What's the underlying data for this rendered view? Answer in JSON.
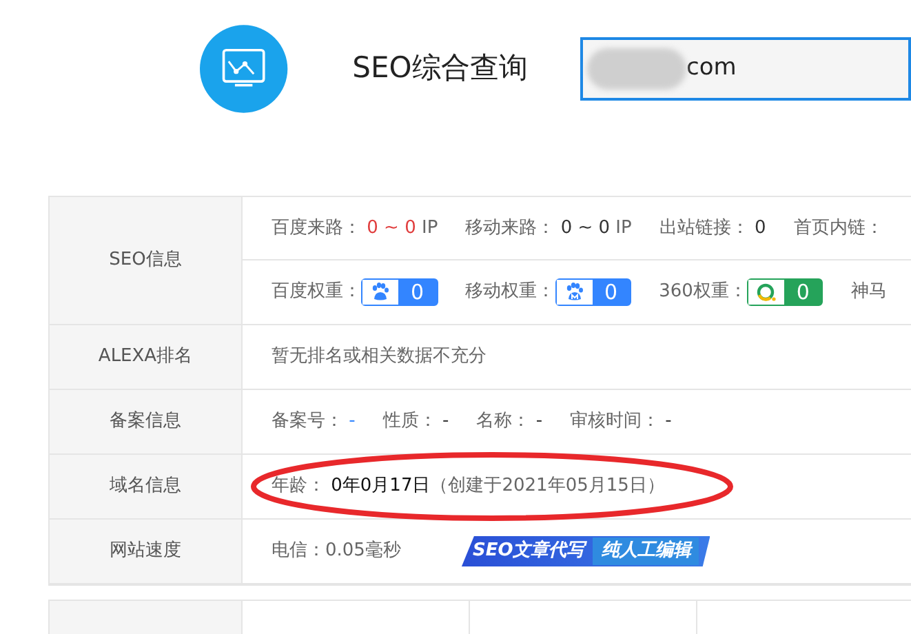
{
  "header": {
    "title": "SEO综合查询",
    "domain_field": {
      "value": "com",
      "redacted": true
    }
  },
  "rows": [
    {
      "label": "SEO信息",
      "lines": [
        [
          {
            "kind": "text",
            "label": "百度来路：",
            "value": "0 ~ 0",
            "suffix": "IP",
            "color": "#e03c3c"
          },
          {
            "kind": "text",
            "label": "移动来路：",
            "value": "0 ~ 0",
            "suffix": "IP",
            "color": "#333333"
          },
          {
            "kind": "text",
            "label": "出站链接：",
            "value": "0",
            "color": "#333333"
          },
          {
            "kind": "text",
            "label": "首页内链："
          }
        ],
        [
          {
            "kind": "pawbadge",
            "label": "百度权重：",
            "value": "0",
            "color": "#3385ff"
          },
          {
            "kind": "mobilepawbadge",
            "label": "移动权重：",
            "value": "0",
            "color": "#3385ff"
          },
          {
            "kind": "ringbadge",
            "label": "360权重：",
            "value": "0",
            "color": "#25a35a"
          },
          {
            "kind": "text",
            "label": "神马"
          }
        ]
      ]
    },
    {
      "label": "ALEXA排名",
      "lines": [
        [
          {
            "kind": "text",
            "label": "暂无排名或相关数据不充分"
          }
        ]
      ]
    },
    {
      "label": "备案信息",
      "lines": [
        [
          {
            "kind": "text",
            "label": "备案号：",
            "value": "-",
            "color": "#3385ff"
          },
          {
            "kind": "text",
            "label": "性质：",
            "value": "-",
            "color": "#333333"
          },
          {
            "kind": "text",
            "label": "名称：",
            "value": "-",
            "color": "#333333"
          },
          {
            "kind": "text",
            "label": "审核时间：",
            "value": "-",
            "color": "#333333"
          }
        ]
      ]
    },
    {
      "label": "域名信息",
      "circled": true,
      "lines": [
        [
          {
            "kind": "text",
            "label": "年龄：",
            "value": "0年0月17日",
            "color": "#111111",
            "suffix": "（创建于2021年05月15日）"
          }
        ]
      ]
    },
    {
      "label": "网站速度",
      "lines": [
        [
          {
            "kind": "text",
            "label": "电信：0.05毫秒"
          },
          {
            "kind": "ad",
            "value": "SEO文章代写",
            "suffix": "纯人工编辑"
          }
        ]
      ]
    }
  ]
}
